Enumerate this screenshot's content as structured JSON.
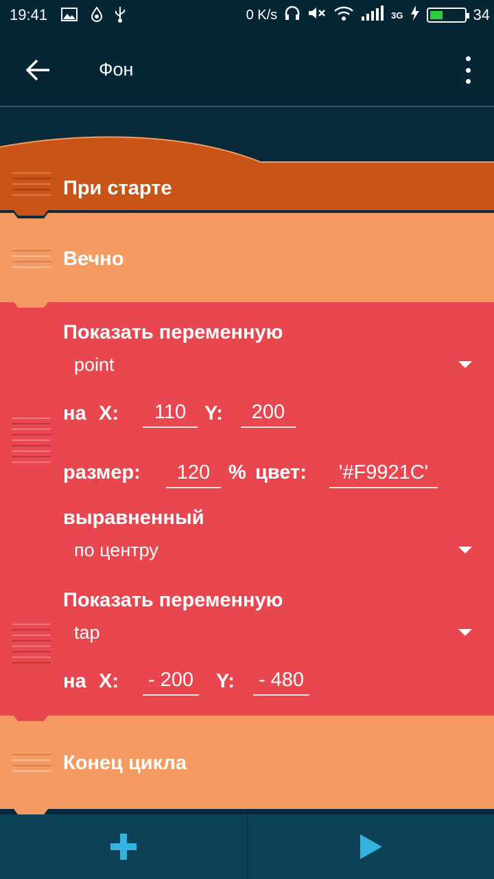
{
  "status_bar": {
    "time": "19:41",
    "net_speed": "0 K/s",
    "battery": "34",
    "network": "3G",
    "icons": [
      "image-icon",
      "water-drop-icon",
      "usb-icon",
      "headphones-icon",
      "mute-icon",
      "wifi-icon",
      "signal-icon",
      "charging-icon",
      "battery-icon"
    ]
  },
  "app_bar": {
    "title": "Фон",
    "back_icon": "arrow-left-icon",
    "menu_icon": "more-vert-icon"
  },
  "blocks": {
    "when_start": {
      "label": "При старте",
      "color": "#C85418"
    },
    "forever": {
      "label": "Вечно",
      "color": "#F69A63"
    },
    "show_var_1": {
      "title": "Показать переменную",
      "variable": "point",
      "at_label": "на",
      "x_label": "X:",
      "x_value": "110",
      "y_label": "Y:",
      "y_value": "200",
      "size_label": "размер:",
      "size_value": "120",
      "percent": "%",
      "color_label": "цвет:",
      "color_value": "'#F9921C'",
      "align_label": "выравненный",
      "align_value": "по центру",
      "color": "#E9474F"
    },
    "show_var_2": {
      "title": "Показать переменную",
      "variable": "tap",
      "at_label": "на",
      "x_label": "X:",
      "x_value": "- 200",
      "y_label": "Y:",
      "y_value": "- 480",
      "color": "#E9474F"
    },
    "end_loop": {
      "label": "Конец цикла",
      "color": "#F69A63"
    }
  },
  "bottom_bar": {
    "add_icon": "plus-icon",
    "play_icon": "play-icon",
    "add_color": "#35B3E0",
    "play_color": "#35B3E0"
  }
}
